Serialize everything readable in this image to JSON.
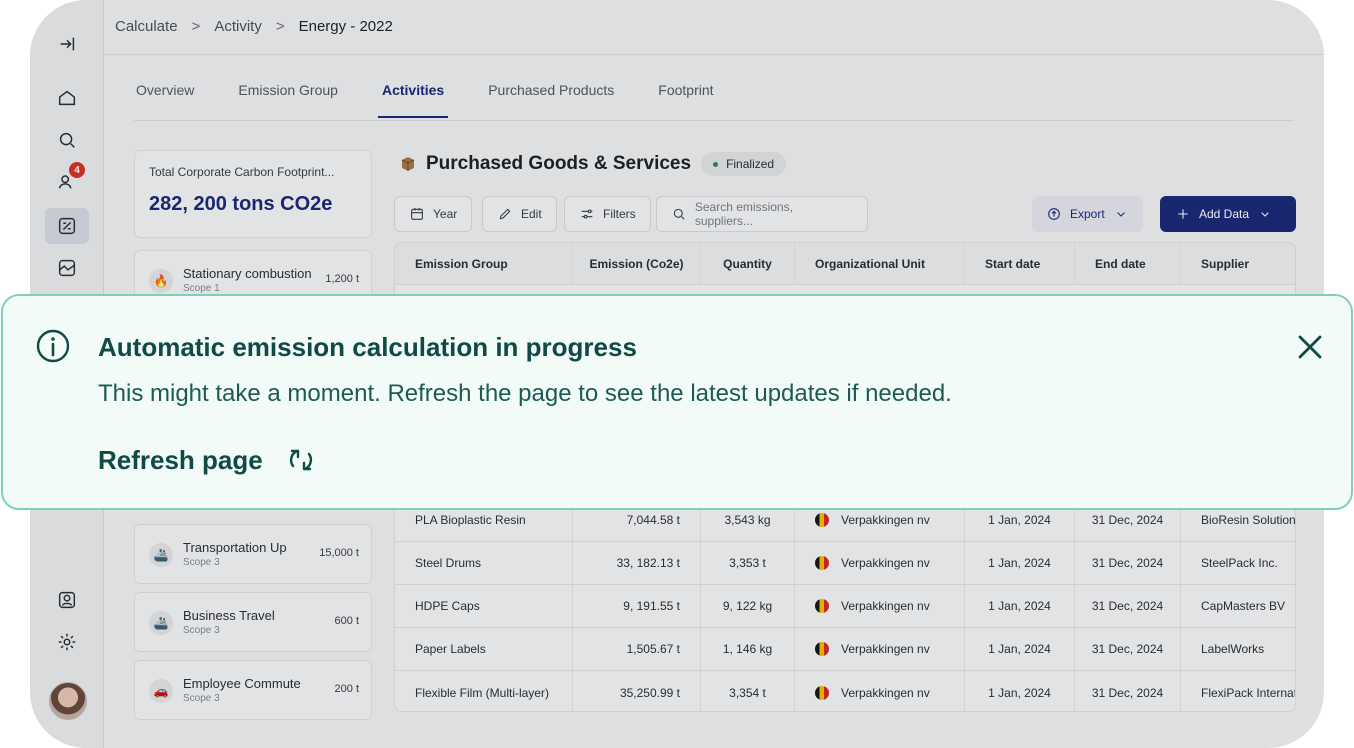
{
  "breadcrumb": {
    "item1": "Calculate",
    "item2": "Activity",
    "current": "Energy - 2022"
  },
  "sidebar": {
    "notification_count": "4"
  },
  "tabs": [
    "Overview",
    "Emission Group",
    "Activities",
    "Purchased Products",
    "Footprint"
  ],
  "summary": {
    "label": "Total Corporate Carbon Footprint...",
    "value": "282, 200 tons CO2e"
  },
  "categories": [
    {
      "name": "Stationary combustion",
      "scope": "Scope 1",
      "value": "1,200 t"
    },
    {
      "name": "Transportation Up",
      "scope": "Scope 3",
      "value": "15,000 t"
    },
    {
      "name": "Business Travel",
      "scope": "Scope 3",
      "value": "600 t"
    },
    {
      "name": "Employee Commute",
      "scope": "Scope 3",
      "value": "200 t"
    }
  ],
  "section": {
    "title": "Purchased Goods & Services",
    "status": "Finalized"
  },
  "toolbar": {
    "year": "Year",
    "edit": "Edit",
    "filters": "Filters",
    "search_placeholder": "Search emissions, suppliers...",
    "export": "Export",
    "add_data": "Add Data"
  },
  "table": {
    "headers": [
      "Emission Group",
      "Emission (Co2e)",
      "Quantity",
      "Organizational Unit",
      "Start date",
      "End date",
      "Supplier"
    ],
    "rows": [
      [
        "PLA Bioplastic Resin",
        "7,044.58 t",
        "3,543 kg",
        "Verpakkingen nv",
        "1 Jan, 2024",
        "31 Dec, 2024",
        "BioResin Solutions"
      ],
      [
        "Steel Drums",
        "33, 182.13 t",
        "3,353 t",
        "Verpakkingen nv",
        "1 Jan, 2024",
        "31 Dec, 2024",
        "SteelPack Inc."
      ],
      [
        "HDPE Caps",
        "9, 191.55 t",
        "9, 122 kg",
        "Verpakkingen nv",
        "1 Jan, 2024",
        "31 Dec, 2024",
        "CapMasters BV"
      ],
      [
        "Paper Labels",
        "1,505.67 t",
        "1, 146 kg",
        "Verpakkingen nv",
        "1 Jan, 2024",
        "31 Dec, 2024",
        "LabelWorks"
      ],
      [
        "Flexible Film (Multi-layer)",
        "35,250.99 t",
        "3,354 t",
        "Verpakkingen nv",
        "1 Jan, 2024",
        "31 Dec, 2024",
        "FlexiPack International"
      ]
    ]
  },
  "toast": {
    "title": "Automatic emission calculation in progress",
    "body": "This might take a moment. Refresh the page to see the latest updates if needed.",
    "action": "Refresh page"
  },
  "colors": {
    "brand": "#1c2a7a",
    "toast_border": "#7ecfbd",
    "toast_bg": "#f2fbf8",
    "toast_text": "#0f4a44",
    "badge": "#d8342a"
  }
}
